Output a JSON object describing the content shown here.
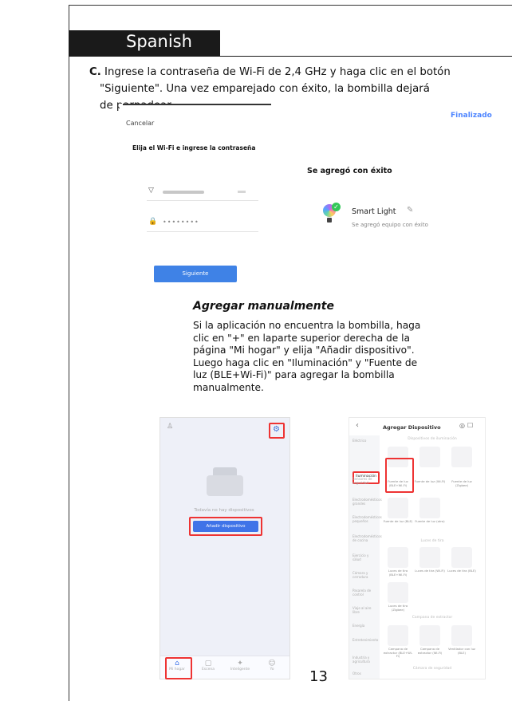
{
  "header": {
    "language": "Spanish"
  },
  "step_c": {
    "letter": "C.",
    "line1": "Ingrese la contraseña de Wi-Fi de 2,4 GHz y haga clic en el botón",
    "line2": "\"Siguiente\". Una vez emparejado  con éxito, la bombilla dejará",
    "line3": "de parpadear."
  },
  "screen_wifi": {
    "cancel": "Cancelar",
    "title": "Elija el Wi-Fi e ingrese la contraseña",
    "password_mask": "••••••••",
    "next_button": "Siguiente"
  },
  "screen_success": {
    "done_link": "Finalizado",
    "title": "Se agregó con éxito",
    "device_name": "Smart Light",
    "device_status": "Se agregó equipo con éxito"
  },
  "manual": {
    "title": "Agregar manualmente",
    "lines": [
      "Si la aplicación no encuentra la bombilla, haga",
      "clic en \"+\" en laparte superior derecha de la",
      "página \"Mi hogar\" y elija \"Añadir dispositivo\".",
      "Luego haga clic en \"Iluminación\" y \"Fuente de",
      "luz (BLE+Wi-Fi)\" para agregar la bombilla",
      "manualmente."
    ]
  },
  "screen_home": {
    "no_devices": "Todavía no hay dispositivos",
    "add_device_button": "Añadir dispositivo",
    "tabs": [
      "Mi hogar",
      "Escena",
      "Inteligente",
      "Yo"
    ]
  },
  "screen_add_device": {
    "title": "Agregar Dispositivo",
    "category_selected": "Iluminación",
    "subheading": "Dispositivos de iluminación",
    "subheading2": "Luces de tira",
    "subheading3": "Campana de extractor",
    "subheading4": "Cámara de seguridad",
    "tiles": [
      "Fuente de luz (BLE+Wi-Fi)",
      "Fuente de luz (Wi-Fi)",
      "Fuente de luz (Zigbee)",
      "Fuente de luz (BLE)",
      "Fuente de luz (otro)",
      "Luces de tira (BLE+Wi-Fi)",
      "Luces de tira (Wi-Fi)",
      "Luces de tira (BLE)",
      "Luces de tira (Zigbee)",
      "Campana de extractor (BLE+Wi-Fi)",
      "Campana de extractor (Wi-Fi)",
      "Ventilador con luz (BLE)"
    ],
    "left_items": [
      "Eléctrico",
      "Sensores de seguridad",
      "Electrodomésticos grandes",
      "Electrodomésticos pequeños",
      "Electrodomésticos de cocina",
      "Ejercicio y salud",
      "Cámara y cerradura",
      "Pasarela de control",
      "Viaje al aire libre",
      "Energía",
      "Entretenimiento",
      "Industria y agricultura",
      "Otros"
    ]
  },
  "page_number": "13"
}
